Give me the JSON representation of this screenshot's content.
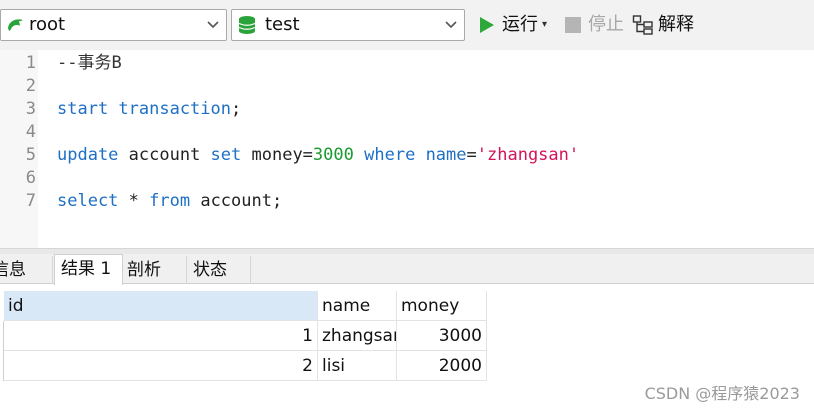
{
  "toolbar": {
    "connection": {
      "value": "root",
      "icon": "dolphin-icon"
    },
    "database": {
      "value": "test",
      "icon": "database-icon"
    },
    "run_label": "运行",
    "stop_label": "停止",
    "explain_label": "解释",
    "colors": {
      "run": "#2fa83b",
      "db": "#2aa33a",
      "stop": "#b5b5b5"
    }
  },
  "editor": {
    "lines": [
      {
        "n": "1",
        "tokens": [
          {
            "t": "--事务B",
            "c": "cm"
          }
        ]
      },
      {
        "n": "2",
        "tokens": []
      },
      {
        "n": "3",
        "tokens": [
          {
            "t": "start transaction",
            "c": "kw"
          },
          {
            "t": ";",
            "c": "id"
          }
        ]
      },
      {
        "n": "4",
        "tokens": []
      },
      {
        "n": "5",
        "tokens": [
          {
            "t": "update",
            "c": "kw"
          },
          {
            "t": " account ",
            "c": "id"
          },
          {
            "t": "set",
            "c": "kw"
          },
          {
            "t": " money=",
            "c": "id"
          },
          {
            "t": "3000",
            "c": "nm"
          },
          {
            "t": " ",
            "c": "id"
          },
          {
            "t": "where",
            "c": "kw"
          },
          {
            "t": " ",
            "c": "id"
          },
          {
            "t": "name",
            "c": "kw"
          },
          {
            "t": "=",
            "c": "id"
          },
          {
            "t": "'zhangsan'",
            "c": "st"
          }
        ]
      },
      {
        "n": "6",
        "tokens": []
      },
      {
        "n": "7",
        "tokens": [
          {
            "t": "select",
            "c": "kw"
          },
          {
            "t": " * ",
            "c": "id"
          },
          {
            "t": "from",
            "c": "kw"
          },
          {
            "t": " account;",
            "c": "id"
          }
        ]
      }
    ]
  },
  "tabs": [
    {
      "label": "信息",
      "active": false
    },
    {
      "label": "结果 1",
      "active": true
    },
    {
      "label": "剖析",
      "active": false
    },
    {
      "label": "状态",
      "active": false
    }
  ],
  "results": {
    "columns": [
      "id",
      "name",
      "money"
    ],
    "rows": [
      [
        "1",
        "zhangsan",
        "3000"
      ],
      [
        "2",
        "lisi",
        "2000"
      ]
    ]
  },
  "watermark": "CSDN @程序猿2023"
}
